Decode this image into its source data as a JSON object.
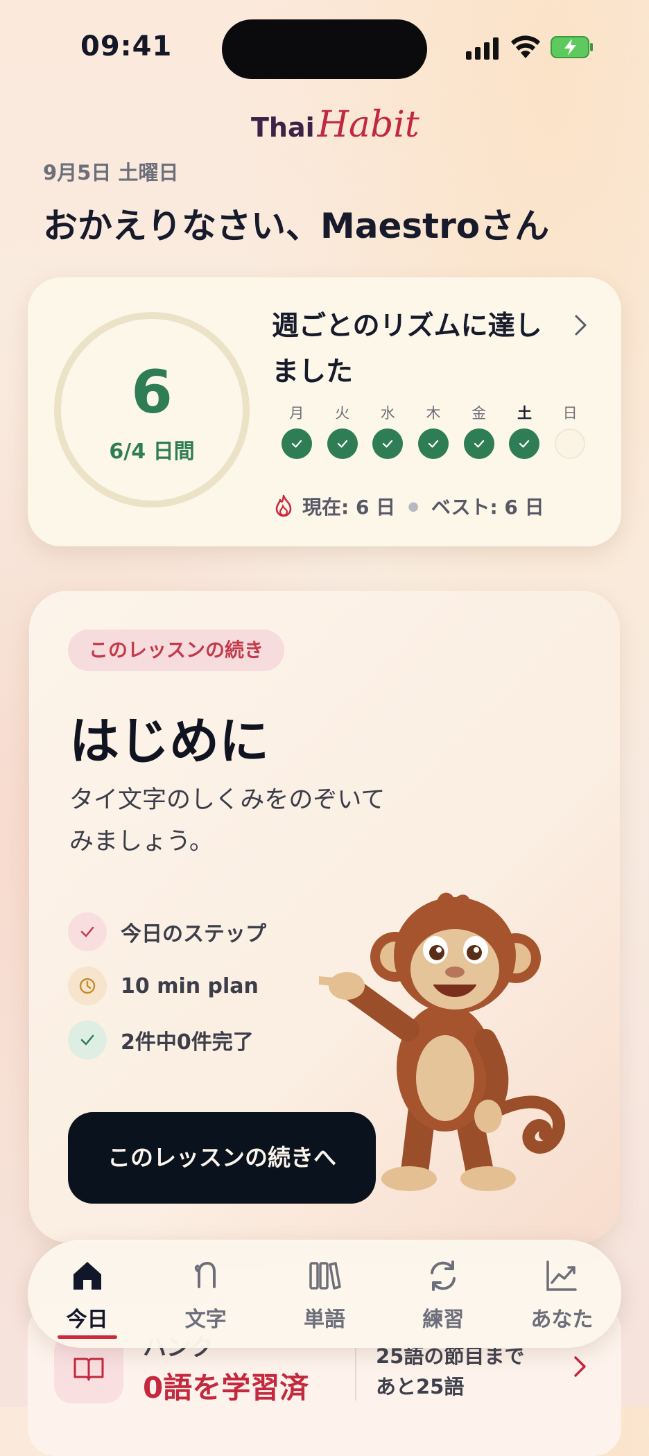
{
  "status_bar": {
    "time": "09:41"
  },
  "brand": {
    "part1": "Thai",
    "part2": "Habit"
  },
  "header": {
    "date": "9月5日 土曜日",
    "greeting": "おかえりなさい、Maestroさん"
  },
  "streak": {
    "count": "6",
    "ratio_label": "6/4 日間",
    "title": "週ごとのリズムに達しました",
    "days": [
      {
        "label": "月",
        "done": true
      },
      {
        "label": "火",
        "done": true
      },
      {
        "label": "水",
        "done": true
      },
      {
        "label": "木",
        "done": true
      },
      {
        "label": "金",
        "done": true
      },
      {
        "label": "土",
        "done": true,
        "today": true
      },
      {
        "label": "日",
        "done": false
      }
    ],
    "current_label": "現在: 6 日",
    "best_label": "ベスト: 6 日",
    "accent_color": "#2e7d55"
  },
  "lesson": {
    "badge": "このレッスンの続き",
    "title": "はじめに",
    "description": "タイ文字のしくみをのぞいてみましょう。",
    "steps": [
      {
        "icon": "check-icon",
        "text": "今日のステップ"
      },
      {
        "icon": "clock-icon",
        "text": "10 min plan"
      },
      {
        "icon": "check-icon",
        "text": "2件中0件完了"
      }
    ],
    "cta": "このレッスンの続きへ"
  },
  "vocab": {
    "heading": "ハンク",
    "learned": "0語を学習済",
    "goal_line1": "25語の節目まで",
    "goal_line2": "あと25語"
  },
  "tabs": [
    {
      "label": "今日",
      "icon": "home-icon",
      "active": true
    },
    {
      "label": "文字",
      "icon": "thai-letter-icon",
      "active": false
    },
    {
      "label": "単語",
      "icon": "books-icon",
      "active": false
    },
    {
      "label": "練習",
      "icon": "refresh-icon",
      "active": false
    },
    {
      "label": "あなた",
      "icon": "chart-icon",
      "active": false
    }
  ],
  "colors": {
    "brand_red": "#c92a40",
    "ink": "#0a121d",
    "green": "#2e7d55"
  }
}
